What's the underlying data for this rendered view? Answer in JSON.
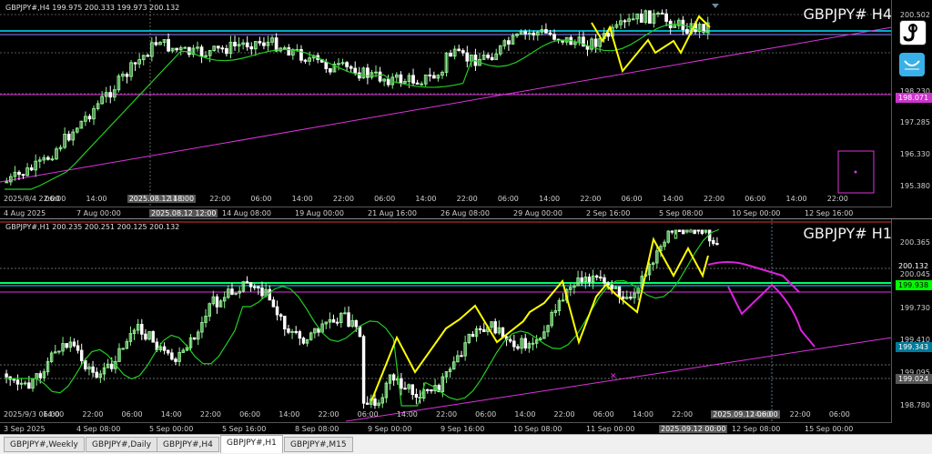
{
  "top_chart": {
    "info": "GBPJPY#,H4  199.975 200.333 199.973 200.132",
    "title": "GBPJPY# H4",
    "price_labels": [
      "200.502",
      "198.230",
      "197.285",
      "196.330",
      "195.380"
    ],
    "price_tag": "198.071",
    "price_tag_color": "#e040e0",
    "time_labels": [
      "4 Aug 2025",
      "7 Aug 00:00",
      "2025.08.12 12:00",
      "14 Aug 08:00",
      "19 Aug 00:00",
      "21 Aug 16:00",
      "26 Aug 08:00",
      "29 Aug 00:00",
      "2 Sep 16:00",
      "5 Sep 08:00",
      "10 Sep 00:00",
      "12 Sep 16:00"
    ],
    "inner_time_labels": [
      "2025/8/4 22:00",
      "06:00",
      "14:00",
      "2025.08.12 18:00",
      "14:00",
      "22:00",
      "06:00",
      "14:00",
      "22:00",
      "06:00",
      "14:00",
      "22:00",
      "06:00",
      "14:00",
      "22:00",
      "06:00",
      "14:00",
      "22:00",
      "06:00",
      "14:00",
      "22:00"
    ]
  },
  "bottom_chart": {
    "info": "GBPJPY#,H1  200.235 200.251 200.125 200.132",
    "title": "GBPJPY# H1",
    "price_labels": [
      "200.365",
      "200.132",
      "200.045",
      "199.938",
      "199.730",
      "199.410",
      "199.343",
      "199.095",
      "199.024",
      "198.780"
    ],
    "price_tags": [
      {
        "text": "200.132",
        "color": "#ffffff",
        "bg": "#000000"
      },
      {
        "text": "199.938",
        "color": "#000000",
        "bg": "#00ff00"
      },
      {
        "text": "199.343",
        "color": "#ffffff",
        "bg": "#007a9a"
      },
      {
        "text": "199.024",
        "color": "#ffffff",
        "bg": "#555555"
      }
    ],
    "time_labels": [
      "3 Sep 2025",
      "4 Sep 08:00",
      "5 Sep 00:00",
      "5 Sep 16:00",
      "8 Sep 08:00",
      "9 Sep 00:00",
      "9 Sep 16:00",
      "10 Sep 08:00",
      "11 Sep 00:00",
      "2025.09.12 00:00",
      "12 Sep 08:00",
      "15 Sep 00:00"
    ],
    "inner_time_labels": [
      "2025/9/3 06:00",
      "14:00",
      "22:00",
      "06:00",
      "14:00",
      "22:00",
      "06:00",
      "14:00",
      "22:00",
      "06:00",
      "14:00",
      "22:00",
      "06:00",
      "14:00",
      "22:00",
      "06:00",
      "14:00",
      "22:00",
      "2025.09.12 06:00",
      "14:00",
      "22:00",
      "06:00"
    ]
  },
  "tabs": [
    {
      "label": "GBPJPY#,Weekly",
      "active": false
    },
    {
      "label": "GBPJPY#,Daily",
      "active": false
    },
    {
      "label": "GBPJPY#,H4",
      "active": false
    },
    {
      "label": "GBPJPY#,H1",
      "active": true
    },
    {
      "label": "GBPJPY#,M15",
      "active": false
    }
  ],
  "side_buttons": [
    {
      "icon": "fishing-hook-icon",
      "color": "#ffffff"
    },
    {
      "icon": "smile-curve-icon",
      "color": "#3ab0e8"
    }
  ],
  "colors": {
    "bull": "#90ee90",
    "bear": "#ffffff",
    "ma": "#22cc22",
    "zigzag": "#ffff00",
    "trendline": "#dd33dd",
    "level_cyan": "#00e5ff",
    "forecast": "#dd22dd"
  }
}
